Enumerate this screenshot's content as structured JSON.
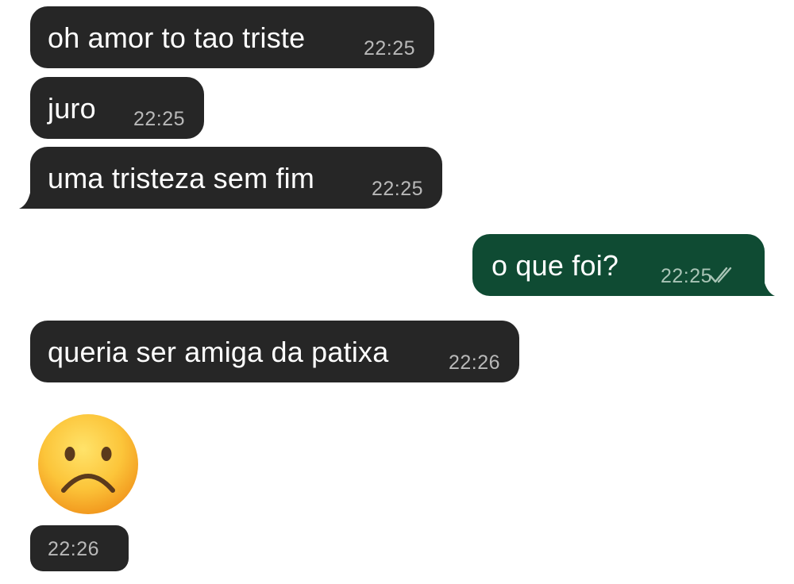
{
  "messages": [
    {
      "direction": "incoming",
      "text": "oh amor to tao triste",
      "time": "22:25"
    },
    {
      "direction": "incoming",
      "text": "juro",
      "time": "22:25"
    },
    {
      "direction": "incoming",
      "text": "uma tristeza sem fim",
      "time": "22:25"
    },
    {
      "direction": "outgoing",
      "text": "o que foi?",
      "time": "22:25",
      "status": "read-double-check-icon"
    },
    {
      "direction": "incoming",
      "text": "queria ser amiga da patixa",
      "time": "22:26"
    },
    {
      "direction": "incoming",
      "type": "emoji",
      "emoji": "slightly-frowning-face",
      "time": "22:26"
    }
  ],
  "colors": {
    "incoming_bubble": "#262626",
    "outgoing_bubble": "#0f4b33",
    "background": "#ffffff",
    "timestamp": "#b9b9b9"
  }
}
